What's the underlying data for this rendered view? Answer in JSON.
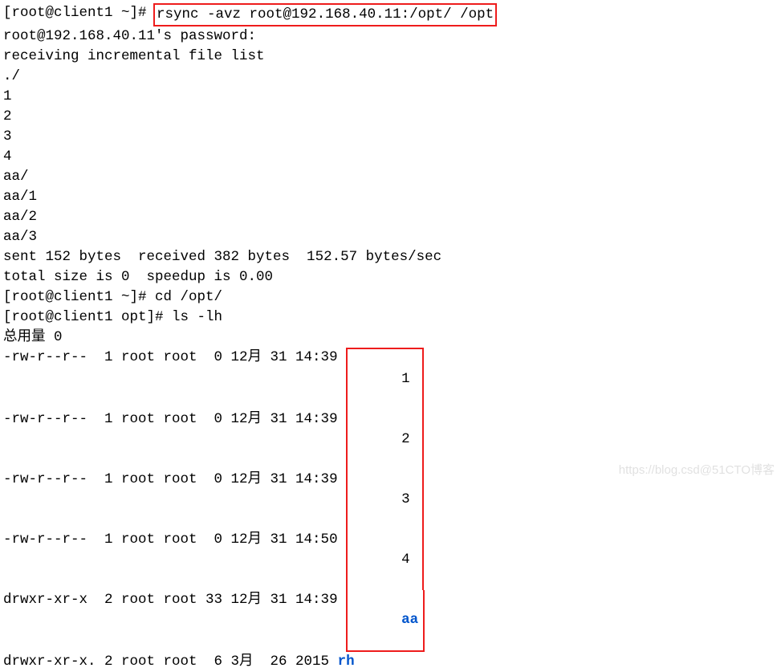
{
  "prompt1": {
    "prefix": "[root@client1 ~]# ",
    "command": "rsync -avz root@192.168.40.11:/opt/ /opt"
  },
  "output": {
    "pwline": "root@192.168.40.11's password:",
    "recv": "receiving incremental file list",
    "list": [
      "./",
      "1",
      "2",
      "3",
      "4",
      "aa/",
      "aa/1",
      "aa/2",
      "aa/3"
    ],
    "blank1": "",
    "sent": "sent 152 bytes  received 382 bytes  152.57 bytes/sec",
    "total": "total size is 0  speedup is 0.00"
  },
  "prompt2": {
    "prefix": "[root@client1 ~]# ",
    "command": "cd /opt/"
  },
  "prompt3": {
    "prefix": "[root@client1 opt]# ",
    "command": "ls -lh"
  },
  "ls": {
    "header": "总用量 0",
    "rows": [
      {
        "meta": "-rw-r--r--  1 root root  0 12月 31 14:39",
        "name": "1",
        "dir": false
      },
      {
        "meta": "-rw-r--r--  1 root root  0 12月 31 14:39",
        "name": "2",
        "dir": false
      },
      {
        "meta": "-rw-r--r--  1 root root  0 12月 31 14:39",
        "name": "3",
        "dir": false
      },
      {
        "meta": "-rw-r--r--  1 root root  0 12月 31 14:50",
        "name": "4",
        "dir": false
      },
      {
        "meta": "drwxr-xr-x  2 root root 33 12月 31 14:39",
        "name": "aa",
        "dir": true
      }
    ],
    "tail": {
      "meta": "drwxr-xr-x. 2 root root  6 3月  26 2015 ",
      "name": "rh",
      "dir": true
    }
  },
  "watermark": "https://blog.csd@51CTO博客"
}
